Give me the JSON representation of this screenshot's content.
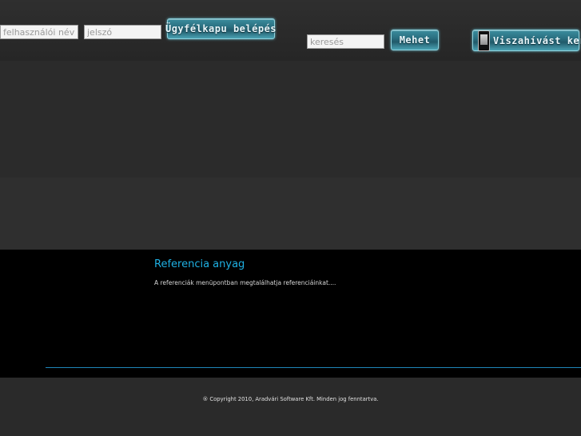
{
  "login": {
    "username_placeholder": "felhasználói név",
    "password_placeholder": "jelszó",
    "button_label": "Ügyfélkapu belépés"
  },
  "search": {
    "placeholder": "keresés",
    "button_label": "Mehet"
  },
  "callback": {
    "button_label": "Viszahívást kerek",
    "icon": "phone-icon"
  },
  "main": {
    "heading": "Referencia anyag",
    "text": "A referenciák menüpontban megtalálhatja referenciáinkat...."
  },
  "footer": {
    "copyright": "® Copyright 2010, Aradvári Software Kft. Minden jog fenntartva."
  },
  "colors": {
    "accent": "#1fb1e4",
    "button": "#2a6f80",
    "background": "#2b2b2b",
    "content_background": "#000000"
  }
}
